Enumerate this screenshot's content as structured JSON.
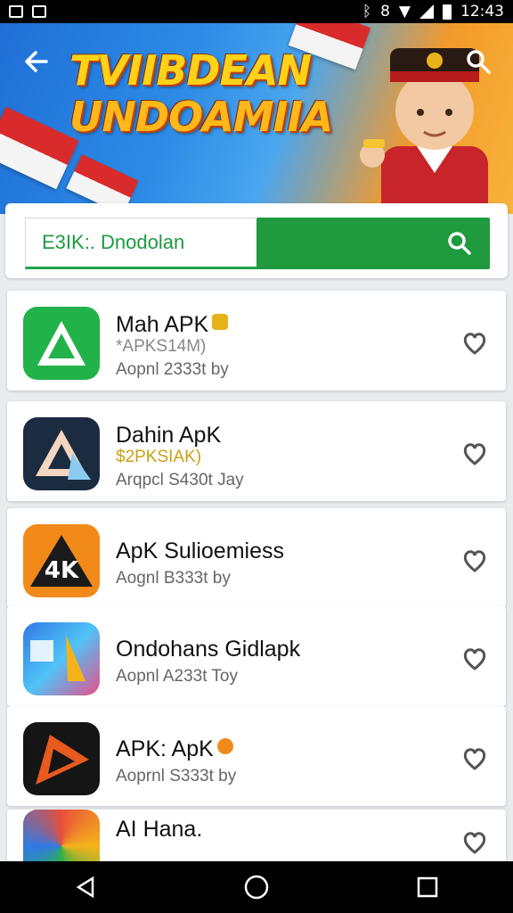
{
  "status_bar": {
    "time": "12:43",
    "network": "8"
  },
  "banner": {
    "title_line1": "TVIIBDEAN",
    "title_line2": "UNDOAMIIA"
  },
  "search": {
    "value": "E3IK:. Dnodolan"
  },
  "apps": [
    {
      "name": "Mah APK",
      "size": "*APKS14M)",
      "date": "Aopnl 2333t by",
      "size_color": "#999999",
      "badge_color": "#e8b21a"
    },
    {
      "name": "Dahin ApK",
      "size": "$2PKSIAK)",
      "date": "Arqpcl S430t Jay",
      "size_color": "#c9a014"
    },
    {
      "name": "ApK Sulioemiess",
      "date": "Aognl B333t by"
    },
    {
      "name": "Ondohans Gidlapk",
      "date": "Aopnl A233t Toy"
    },
    {
      "name": "APK: ApK",
      "date": "Aoprnl S333t by",
      "badge_color": "#f08a1c"
    },
    {
      "name": "AI Hana.",
      "date": ""
    }
  ],
  "colors": {
    "accent": "#1f9a3f",
    "status_bg": "#000000"
  }
}
